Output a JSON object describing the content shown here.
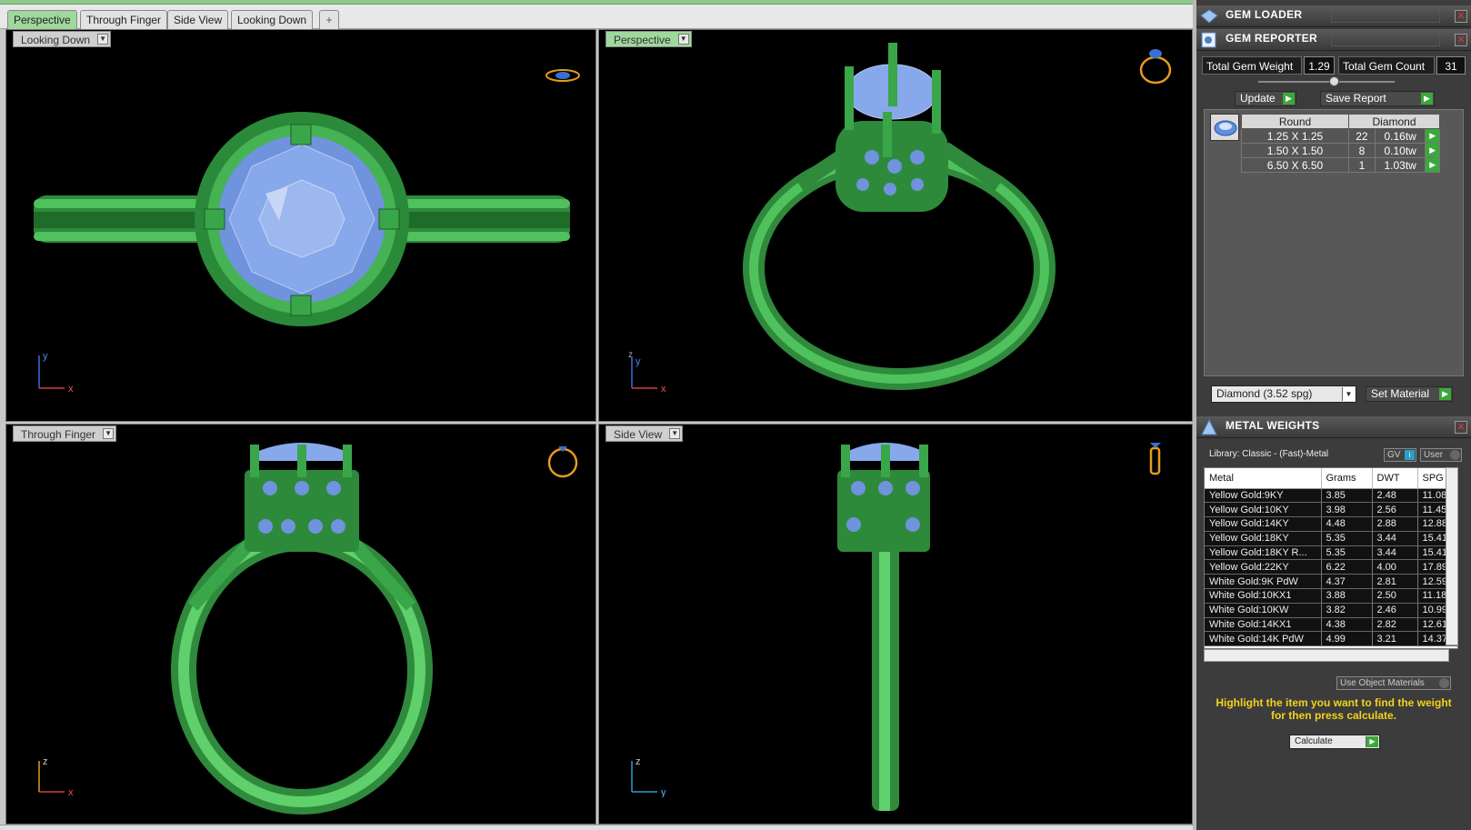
{
  "tabs": [
    {
      "label": "Perspective",
      "active": true
    },
    {
      "label": "Through Finger",
      "active": false
    },
    {
      "label": "Side View",
      "active": false
    },
    {
      "label": "Looking Down",
      "active": false
    }
  ],
  "add_tab_label": "+",
  "viewports": {
    "top_left": {
      "label": "Looking Down",
      "axis_v": "y",
      "axis_h": "x"
    },
    "top_right": {
      "label": "Perspective",
      "axis_v": "z",
      "axis_v2": "y",
      "axis_h": "x"
    },
    "bottom_left": {
      "label": "Through Finger",
      "axis_v": "z",
      "axis_h": "x"
    },
    "bottom_right": {
      "label": "Side View",
      "axis_v": "z",
      "axis_h": "y"
    }
  },
  "gem_loader": {
    "title": "GEM LOADER"
  },
  "gem_reporter": {
    "title": "GEM REPORTER",
    "total_weight_label": "Total Gem Weight",
    "total_weight_value": "1.29",
    "total_count_label": "Total Gem Count",
    "total_count_value": "31",
    "update_label": "Update",
    "save_report_label": "Save Report",
    "table_headers": [
      "Round",
      "Diamond"
    ],
    "rows": [
      {
        "size": "1.25 X 1.25",
        "count": "22",
        "weight": "0.16tw"
      },
      {
        "size": "1.50 X 1.50",
        "count": "8",
        "weight": "0.10tw"
      },
      {
        "size": "6.50 X 6.50",
        "count": "1",
        "weight": "1.03tw"
      }
    ],
    "material_select": "Diamond    (3.52 spg)",
    "set_material_label": "Set Material"
  },
  "metal_weights": {
    "title": "METAL WEIGHTS",
    "library": "Library: Classic - (Fast)-Metal",
    "gv_label": "GV",
    "user_label": "User",
    "headers": [
      "Metal",
      "Grams",
      "DWT",
      "SPG"
    ],
    "rows": [
      [
        "Yellow Gold:9KY",
        "3.85",
        "2.48",
        "11.08"
      ],
      [
        "Yellow Gold:10KY",
        "3.98",
        "2.56",
        "11.45"
      ],
      [
        "Yellow Gold:14KY",
        "4.48",
        "2.88",
        "12.88"
      ],
      [
        "Yellow Gold:18KY",
        "5.35",
        "3.44",
        "15.41"
      ],
      [
        "Yellow Gold:18KY R...",
        "5.35",
        "3.44",
        "15.41"
      ],
      [
        "Yellow Gold:22KY",
        "6.22",
        "4.00",
        "17.89"
      ],
      [
        "White Gold:9K PdW",
        "4.37",
        "2.81",
        "12.59"
      ],
      [
        "White Gold:10KX1",
        "3.88",
        "2.50",
        "11.18"
      ],
      [
        "White Gold:10KW",
        "3.82",
        "2.46",
        "10.99"
      ],
      [
        "White Gold:14KX1",
        "4.38",
        "2.82",
        "12.61"
      ],
      [
        "White Gold:14K PdW",
        "4.99",
        "3.21",
        "14.37"
      ]
    ],
    "use_object_materials": "Use Object Materials",
    "hint": "Highlight the item you want to find the weight for then press calculate.",
    "calculate_label": "Calculate"
  }
}
